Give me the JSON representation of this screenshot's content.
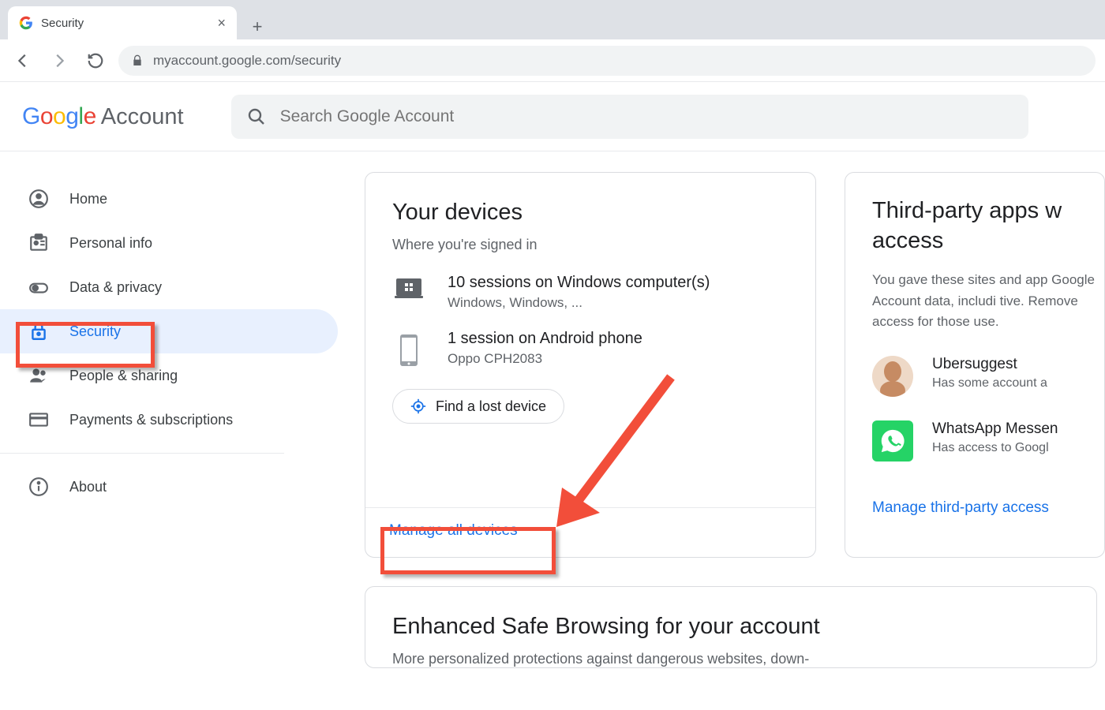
{
  "browser": {
    "tab_title": "Security",
    "url": "myaccount.google.com/security"
  },
  "header": {
    "logo_account": "Account",
    "search_placeholder": "Search Google Account"
  },
  "sidebar": {
    "items": [
      {
        "label": "Home"
      },
      {
        "label": "Personal info"
      },
      {
        "label": "Data & privacy"
      },
      {
        "label": "Security"
      },
      {
        "label": "People & sharing"
      },
      {
        "label": "Payments & subscriptions"
      },
      {
        "label": "About"
      }
    ]
  },
  "devices": {
    "title": "Your devices",
    "subtitle": "Where you're signed in",
    "rows": [
      {
        "main": "10 sessions on Windows computer(s)",
        "sub": "Windows, Windows, ..."
      },
      {
        "main": "1 session on Android phone",
        "sub": "Oppo CPH2083"
      }
    ],
    "find_label": "Find a lost device",
    "footer_link": "Manage all devices"
  },
  "third_party": {
    "title_line1": "Third-party apps w",
    "title_line2": "access",
    "subtitle": "You gave these sites and app Google Account data, includi tive. Remove access for those use.",
    "apps": [
      {
        "name": "Ubersuggest",
        "sub": "Has some account a"
      },
      {
        "name": "WhatsApp Messen",
        "sub": "Has access to Googl"
      }
    ],
    "footer_link": "Manage third-party access"
  },
  "safe_browsing": {
    "title": "Enhanced Safe Browsing for your account",
    "subtitle": "More personalized protections against dangerous websites, down-"
  }
}
